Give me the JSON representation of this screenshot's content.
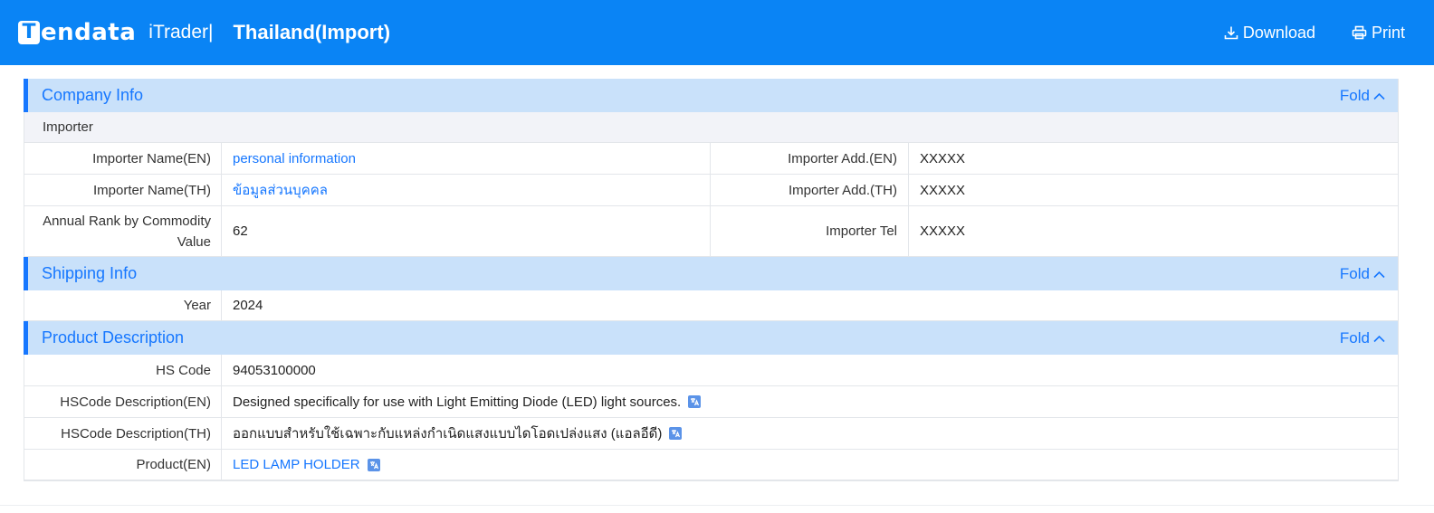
{
  "header": {
    "logo_mark": "T",
    "logo_text": "endata",
    "product": "iTrader|",
    "title": "Thailand(Import)",
    "download_label": "Download",
    "print_label": "Print",
    "background_color": "#0a84f5"
  },
  "company": {
    "title": "Company Info",
    "fold_label": "Fold",
    "subhead": "Importer",
    "fields": {
      "name_en_label": "Importer Name(EN)",
      "name_en_value": "personal information",
      "add_en_label": "Importer Add.(EN)",
      "add_en_value": "XXXXX",
      "name_th_label": "Importer Name(TH)",
      "name_th_value": "ข้อมูลส่วนบุคคล",
      "add_th_label": "Importer Add.(TH)",
      "add_th_value": "XXXXX",
      "rank_label": "Annual Rank by Commodity Value",
      "rank_value": "62",
      "tel_label": "Importer Tel",
      "tel_value": "XXXXX"
    }
  },
  "shipping": {
    "title": "Shipping Info",
    "fold_label": "Fold",
    "year_label": "Year",
    "year_value": "2024"
  },
  "product": {
    "title": "Product Description",
    "fold_label": "Fold",
    "hs_code_label": "HS Code",
    "hs_code_value": "94053100000",
    "hs_desc_en_label": "HSCode Description(EN)",
    "hs_desc_en_value": "Designed specifically for use with Light Emitting Diode (LED) light sources.",
    "hs_desc_th_label": "HSCode Description(TH)",
    "hs_desc_th_value": "ออกแบบสำหรับใช้เฉพาะกับแหล่งกำเนิดแสงแบบไดโอดเปล่งแสง (แอลอีดี)",
    "product_en_label": "Product(EN)",
    "product_en_value": "LED LAMP HOLDER"
  },
  "colors": {
    "accent": "#1677ff",
    "section_bg": "#c9e1fa",
    "subhead_bg": "#f2f3f8"
  }
}
